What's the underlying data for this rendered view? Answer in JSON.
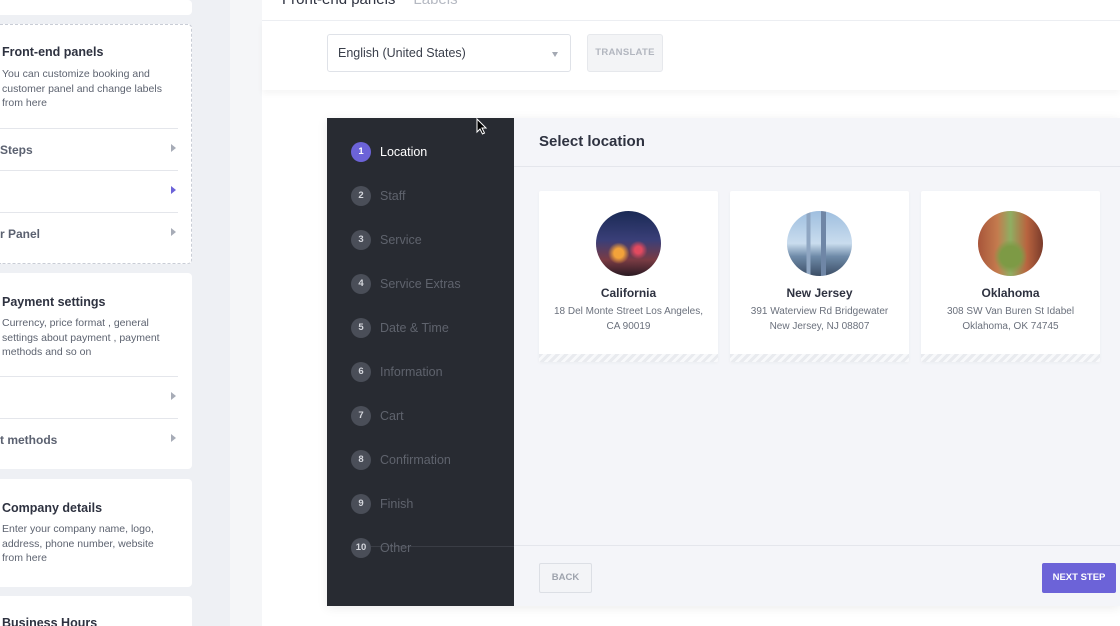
{
  "sidebar": {
    "frontend_card": {
      "title": "Front-end panels",
      "description": "You can customize booking and customer panel and change labels from here",
      "items": [
        {
          "label": "Steps"
        },
        {
          "label": ""
        },
        {
          "label": "r Panel"
        }
      ]
    },
    "payment_card": {
      "title": "Payment settings",
      "description": "Currency, price format , general settings about payment , payment methods and so on",
      "items": [
        {
          "label": ""
        },
        {
          "label": "t methods"
        }
      ]
    },
    "company_card": {
      "title": "Company details",
      "description": "Enter your company name, logo, address, phone number, website from here"
    },
    "business_hours_card": {
      "title": "Business Hours"
    }
  },
  "header": {
    "title": "Front-end panels",
    "subtitle": "Labels"
  },
  "toolbar": {
    "language": "English (United States)",
    "translate_label": "TRANSLATE"
  },
  "booking": {
    "steps": [
      {
        "num": "1",
        "label": "Location"
      },
      {
        "num": "2",
        "label": "Staff"
      },
      {
        "num": "3",
        "label": "Service"
      },
      {
        "num": "4",
        "label": "Service Extras"
      },
      {
        "num": "5",
        "label": "Date & Time"
      },
      {
        "num": "6",
        "label": "Information"
      },
      {
        "num": "7",
        "label": "Cart"
      },
      {
        "num": "8",
        "label": "Confirmation"
      },
      {
        "num": "9",
        "label": "Finish"
      },
      {
        "num": "10",
        "label": "Other"
      }
    ],
    "active_step": 1,
    "panel_title": "Select location",
    "locations": [
      {
        "name": "California",
        "address": "18 Del Monte Street Los Angeles, CA 90019"
      },
      {
        "name": "New Jersey",
        "address": "391 Waterview Rd Bridgewater New Jersey, NJ 08807"
      },
      {
        "name": "Oklahoma",
        "address": "308 SW Van Buren St Idabel Oklahoma, OK 74745"
      }
    ],
    "back_label": "BACK",
    "next_label": "NEXT STEP"
  },
  "colors": {
    "accent": "#6c63d8",
    "steps_bg": "#282b32"
  }
}
